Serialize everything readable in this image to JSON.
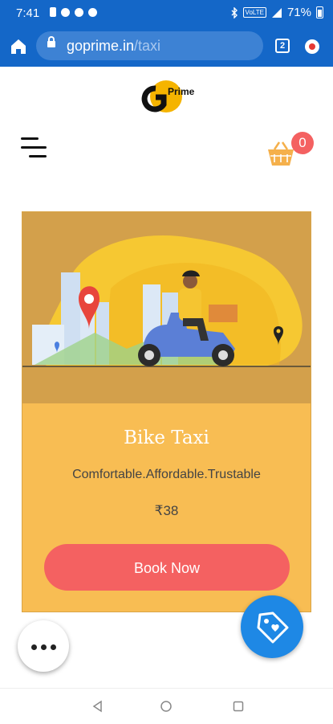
{
  "status_bar": {
    "time": "7:41",
    "battery_text": "71%",
    "volte_label": "VoLTE"
  },
  "browser": {
    "url_host": "goprime.in",
    "url_path": "/taxi",
    "tab_count": "2"
  },
  "header": {
    "logo_text": "Prime",
    "cart_count": "0"
  },
  "card": {
    "title": "Bike Taxi",
    "subtitle": "Comfortable.Affordable.Trustable",
    "price": "₹38",
    "button_label": "Book Now"
  },
  "colors": {
    "browser_blue": "#1467c8",
    "card_bg": "#f8bd53",
    "accent_red": "#f46161",
    "fab_blue": "#1e88e5"
  },
  "icons": {
    "home": "home-icon",
    "lock": "lock-icon",
    "menu": "hamburger-icon",
    "cart": "basket-icon",
    "more": "more-horizontal-icon",
    "tag": "price-tag-icon"
  }
}
